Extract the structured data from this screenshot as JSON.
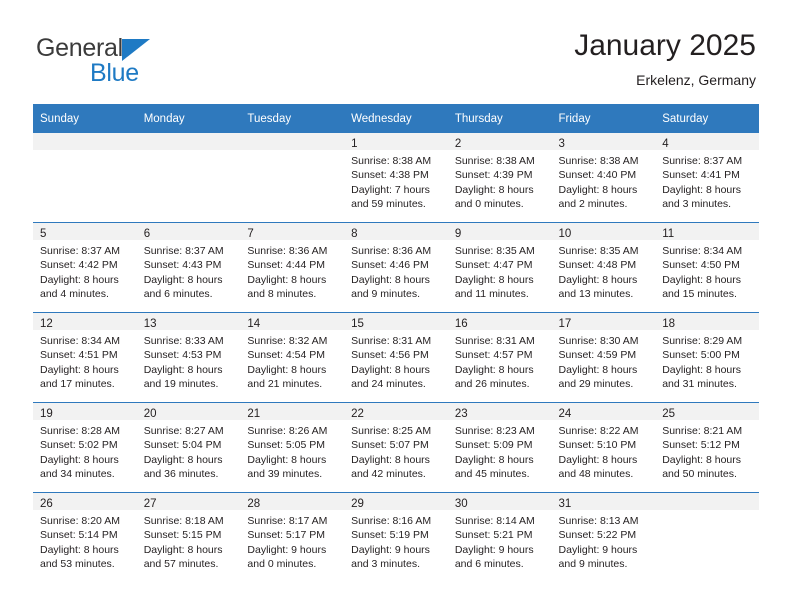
{
  "brand": {
    "name_part1": "General",
    "name_part2": "Blue",
    "accent_color": "#1e7ac4",
    "logo_icon": "triangle-flag-icon"
  },
  "header": {
    "title": "January 2025",
    "subtitle": "Erkelenz, Germany"
  },
  "calendar": {
    "header_bg": "#2f79bd",
    "daynum_bg": "#f2f2f2",
    "weekday_headers": [
      "Sunday",
      "Monday",
      "Tuesday",
      "Wednesday",
      "Thursday",
      "Friday",
      "Saturday"
    ],
    "weeks": [
      [
        {
          "day": "",
          "sunrise": "",
          "sunset": "",
          "daylight_line1": "",
          "daylight_line2": ""
        },
        {
          "day": "",
          "sunrise": "",
          "sunset": "",
          "daylight_line1": "",
          "daylight_line2": ""
        },
        {
          "day": "",
          "sunrise": "",
          "sunset": "",
          "daylight_line1": "",
          "daylight_line2": ""
        },
        {
          "day": "1",
          "sunrise": "Sunrise: 8:38 AM",
          "sunset": "Sunset: 4:38 PM",
          "daylight_line1": "Daylight: 7 hours",
          "daylight_line2": "and 59 minutes."
        },
        {
          "day": "2",
          "sunrise": "Sunrise: 8:38 AM",
          "sunset": "Sunset: 4:39 PM",
          "daylight_line1": "Daylight: 8 hours",
          "daylight_line2": "and 0 minutes."
        },
        {
          "day": "3",
          "sunrise": "Sunrise: 8:38 AM",
          "sunset": "Sunset: 4:40 PM",
          "daylight_line1": "Daylight: 8 hours",
          "daylight_line2": "and 2 minutes."
        },
        {
          "day": "4",
          "sunrise": "Sunrise: 8:37 AM",
          "sunset": "Sunset: 4:41 PM",
          "daylight_line1": "Daylight: 8 hours",
          "daylight_line2": "and 3 minutes."
        }
      ],
      [
        {
          "day": "5",
          "sunrise": "Sunrise: 8:37 AM",
          "sunset": "Sunset: 4:42 PM",
          "daylight_line1": "Daylight: 8 hours",
          "daylight_line2": "and 4 minutes."
        },
        {
          "day": "6",
          "sunrise": "Sunrise: 8:37 AM",
          "sunset": "Sunset: 4:43 PM",
          "daylight_line1": "Daylight: 8 hours",
          "daylight_line2": "and 6 minutes."
        },
        {
          "day": "7",
          "sunrise": "Sunrise: 8:36 AM",
          "sunset": "Sunset: 4:44 PM",
          "daylight_line1": "Daylight: 8 hours",
          "daylight_line2": "and 8 minutes."
        },
        {
          "day": "8",
          "sunrise": "Sunrise: 8:36 AM",
          "sunset": "Sunset: 4:46 PM",
          "daylight_line1": "Daylight: 8 hours",
          "daylight_line2": "and 9 minutes."
        },
        {
          "day": "9",
          "sunrise": "Sunrise: 8:35 AM",
          "sunset": "Sunset: 4:47 PM",
          "daylight_line1": "Daylight: 8 hours",
          "daylight_line2": "and 11 minutes."
        },
        {
          "day": "10",
          "sunrise": "Sunrise: 8:35 AM",
          "sunset": "Sunset: 4:48 PM",
          "daylight_line1": "Daylight: 8 hours",
          "daylight_line2": "and 13 minutes."
        },
        {
          "day": "11",
          "sunrise": "Sunrise: 8:34 AM",
          "sunset": "Sunset: 4:50 PM",
          "daylight_line1": "Daylight: 8 hours",
          "daylight_line2": "and 15 minutes."
        }
      ],
      [
        {
          "day": "12",
          "sunrise": "Sunrise: 8:34 AM",
          "sunset": "Sunset: 4:51 PM",
          "daylight_line1": "Daylight: 8 hours",
          "daylight_line2": "and 17 minutes."
        },
        {
          "day": "13",
          "sunrise": "Sunrise: 8:33 AM",
          "sunset": "Sunset: 4:53 PM",
          "daylight_line1": "Daylight: 8 hours",
          "daylight_line2": "and 19 minutes."
        },
        {
          "day": "14",
          "sunrise": "Sunrise: 8:32 AM",
          "sunset": "Sunset: 4:54 PM",
          "daylight_line1": "Daylight: 8 hours",
          "daylight_line2": "and 21 minutes."
        },
        {
          "day": "15",
          "sunrise": "Sunrise: 8:31 AM",
          "sunset": "Sunset: 4:56 PM",
          "daylight_line1": "Daylight: 8 hours",
          "daylight_line2": "and 24 minutes."
        },
        {
          "day": "16",
          "sunrise": "Sunrise: 8:31 AM",
          "sunset": "Sunset: 4:57 PM",
          "daylight_line1": "Daylight: 8 hours",
          "daylight_line2": "and 26 minutes."
        },
        {
          "day": "17",
          "sunrise": "Sunrise: 8:30 AM",
          "sunset": "Sunset: 4:59 PM",
          "daylight_line1": "Daylight: 8 hours",
          "daylight_line2": "and 29 minutes."
        },
        {
          "day": "18",
          "sunrise": "Sunrise: 8:29 AM",
          "sunset": "Sunset: 5:00 PM",
          "daylight_line1": "Daylight: 8 hours",
          "daylight_line2": "and 31 minutes."
        }
      ],
      [
        {
          "day": "19",
          "sunrise": "Sunrise: 8:28 AM",
          "sunset": "Sunset: 5:02 PM",
          "daylight_line1": "Daylight: 8 hours",
          "daylight_line2": "and 34 minutes."
        },
        {
          "day": "20",
          "sunrise": "Sunrise: 8:27 AM",
          "sunset": "Sunset: 5:04 PM",
          "daylight_line1": "Daylight: 8 hours",
          "daylight_line2": "and 36 minutes."
        },
        {
          "day": "21",
          "sunrise": "Sunrise: 8:26 AM",
          "sunset": "Sunset: 5:05 PM",
          "daylight_line1": "Daylight: 8 hours",
          "daylight_line2": "and 39 minutes."
        },
        {
          "day": "22",
          "sunrise": "Sunrise: 8:25 AM",
          "sunset": "Sunset: 5:07 PM",
          "daylight_line1": "Daylight: 8 hours",
          "daylight_line2": "and 42 minutes."
        },
        {
          "day": "23",
          "sunrise": "Sunrise: 8:23 AM",
          "sunset": "Sunset: 5:09 PM",
          "daylight_line1": "Daylight: 8 hours",
          "daylight_line2": "and 45 minutes."
        },
        {
          "day": "24",
          "sunrise": "Sunrise: 8:22 AM",
          "sunset": "Sunset: 5:10 PM",
          "daylight_line1": "Daylight: 8 hours",
          "daylight_line2": "and 48 minutes."
        },
        {
          "day": "25",
          "sunrise": "Sunrise: 8:21 AM",
          "sunset": "Sunset: 5:12 PM",
          "daylight_line1": "Daylight: 8 hours",
          "daylight_line2": "and 50 minutes."
        }
      ],
      [
        {
          "day": "26",
          "sunrise": "Sunrise: 8:20 AM",
          "sunset": "Sunset: 5:14 PM",
          "daylight_line1": "Daylight: 8 hours",
          "daylight_line2": "and 53 minutes."
        },
        {
          "day": "27",
          "sunrise": "Sunrise: 8:18 AM",
          "sunset": "Sunset: 5:15 PM",
          "daylight_line1": "Daylight: 8 hours",
          "daylight_line2": "and 57 minutes."
        },
        {
          "day": "28",
          "sunrise": "Sunrise: 8:17 AM",
          "sunset": "Sunset: 5:17 PM",
          "daylight_line1": "Daylight: 9 hours",
          "daylight_line2": "and 0 minutes."
        },
        {
          "day": "29",
          "sunrise": "Sunrise: 8:16 AM",
          "sunset": "Sunset: 5:19 PM",
          "daylight_line1": "Daylight: 9 hours",
          "daylight_line2": "and 3 minutes."
        },
        {
          "day": "30",
          "sunrise": "Sunrise: 8:14 AM",
          "sunset": "Sunset: 5:21 PM",
          "daylight_line1": "Daylight: 9 hours",
          "daylight_line2": "and 6 minutes."
        },
        {
          "day": "31",
          "sunrise": "Sunrise: 8:13 AM",
          "sunset": "Sunset: 5:22 PM",
          "daylight_line1": "Daylight: 9 hours",
          "daylight_line2": "and 9 minutes."
        },
        {
          "day": "",
          "sunrise": "",
          "sunset": "",
          "daylight_line1": "",
          "daylight_line2": ""
        }
      ]
    ]
  }
}
